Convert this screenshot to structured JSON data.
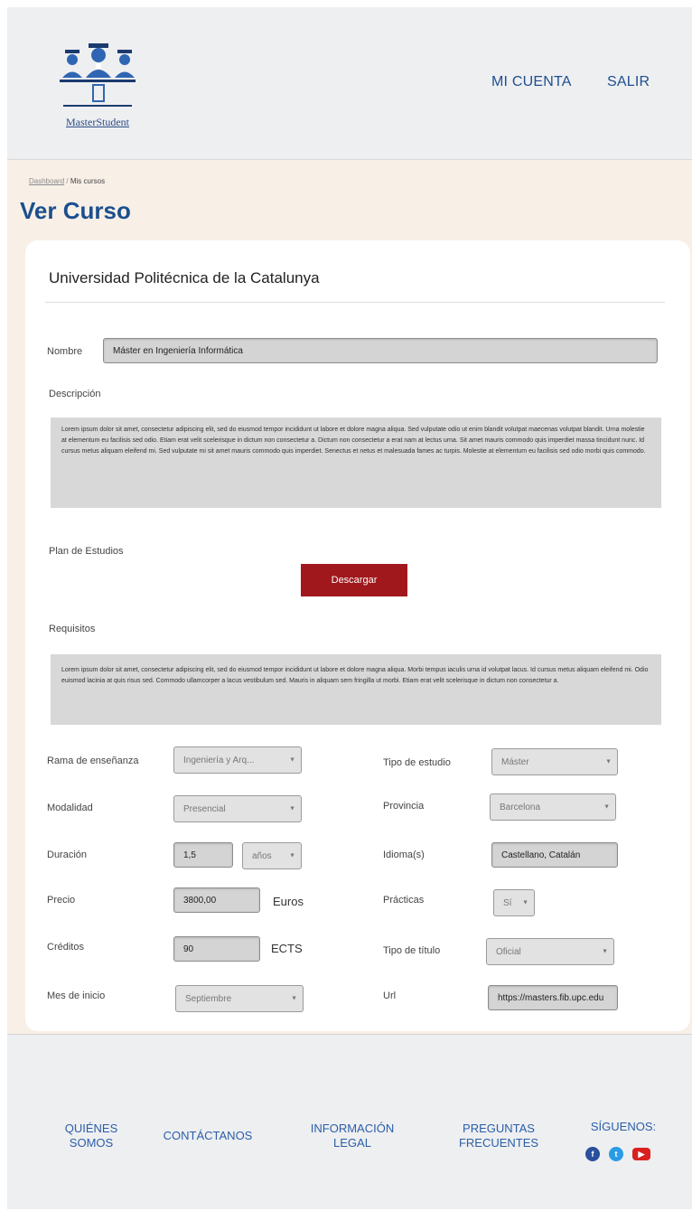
{
  "header": {
    "logo_text": "MasterStudent",
    "nav": {
      "account": "MI CUENTA",
      "logout": "SALIR"
    }
  },
  "breadcrumb": {
    "home": "Dashboard",
    "separator": "/",
    "current": "Mis cursos"
  },
  "page_title": "Ver Curso",
  "course": {
    "university": "Universidad Politécnica de la Catalunya",
    "nombre_label": "Nombre",
    "nombre_value": "Máster en Ingeniería Informática",
    "descripcion_label": "Descripción",
    "descripcion_text": "Lorem ipsum dolor sit amet, consectetur adipiscing elit, sed do eiusmod tempor incididunt ut labore et dolore magna aliqua. Sed vulputate odio ut enim blandit volutpat maecenas volutpat blandit. Urna molestie at elementum eu facilisis sed odio. Etiam erat velit scelerisque in dictum non consectetur a. Dictum non consectetur a erat nam at lectus urna. Sit amet mauris commodo quis imperdiet massa tincidunt nunc. Id cursus metus aliquam eleifend mi. Sed vulputate mi sit amet mauris commodo quis imperdiet. Senectus et netus et malesuada fames ac turpis. Molestie at elementum eu facilisis sed odio morbi quis commodo.",
    "plan_label": "Plan de Estudios",
    "download_button": "Descargar",
    "requisitos_label": "Requisitos",
    "requisitos_text": "Lorem ipsum dolor sit amet, consectetur adipiscing elit, sed do eiusmod tempor incididunt ut labore et dolore magna aliqua. Morbi tempus iaculis urna id volutpat lacus. Id cursus metus aliquam eleifend mi. Odio euismod lacinia at quis risus sed. Commodo ullamcorper a lacus vestibulum sed. Mauris in aliquam sem fringilla ut morbi. Etiam erat velit scelerisque in dictum non consectetur a.",
    "fields": {
      "rama": {
        "label": "Rama de enseñanza",
        "value": "Ingeniería y Arq..."
      },
      "tipo_estudio": {
        "label": "Tipo de estudio",
        "value": "Máster"
      },
      "modalidad": {
        "label": "Modalidad",
        "value": "Presencial"
      },
      "provincia": {
        "label": "Provincia",
        "value": "Barcelona"
      },
      "duracion": {
        "label": "Duración",
        "value": "1,5",
        "unit": "años"
      },
      "idioma": {
        "label": "Idioma(s)",
        "value": "Castellano, Catalán"
      },
      "precio": {
        "label": "Precio",
        "value": "3800,00",
        "unit": "Euros"
      },
      "practicas": {
        "label": "Prácticas",
        "value": "Sí"
      },
      "creditos": {
        "label": "Créditos",
        "value": "90",
        "unit": "ECTS"
      },
      "tipo_titulo": {
        "label": "Tipo de título",
        "value": "Oficial"
      },
      "mes_inicio": {
        "label": "Mes de inicio",
        "value": "Septiembre"
      },
      "url": {
        "label": "Url",
        "value": "https://masters.fib.upc.edu"
      }
    }
  },
  "footer": {
    "quienes_1": "QUIÉNES",
    "quienes_2": "SOMOS",
    "contactanos": "CONTÁCTANOS",
    "info_1": "INFORMACIÓN",
    "info_2": "LEGAL",
    "preguntas_1": "PREGUNTAS",
    "preguntas_2": "FRECUENTES",
    "siguenos": "SÍGUENOS:",
    "icons": [
      "facebook-icon",
      "twitter-icon",
      "youtube-icon"
    ]
  },
  "colors": {
    "brand_blue": "#1b4f8e",
    "button_red": "#a0181c",
    "page_bg": "#f8efe7"
  }
}
